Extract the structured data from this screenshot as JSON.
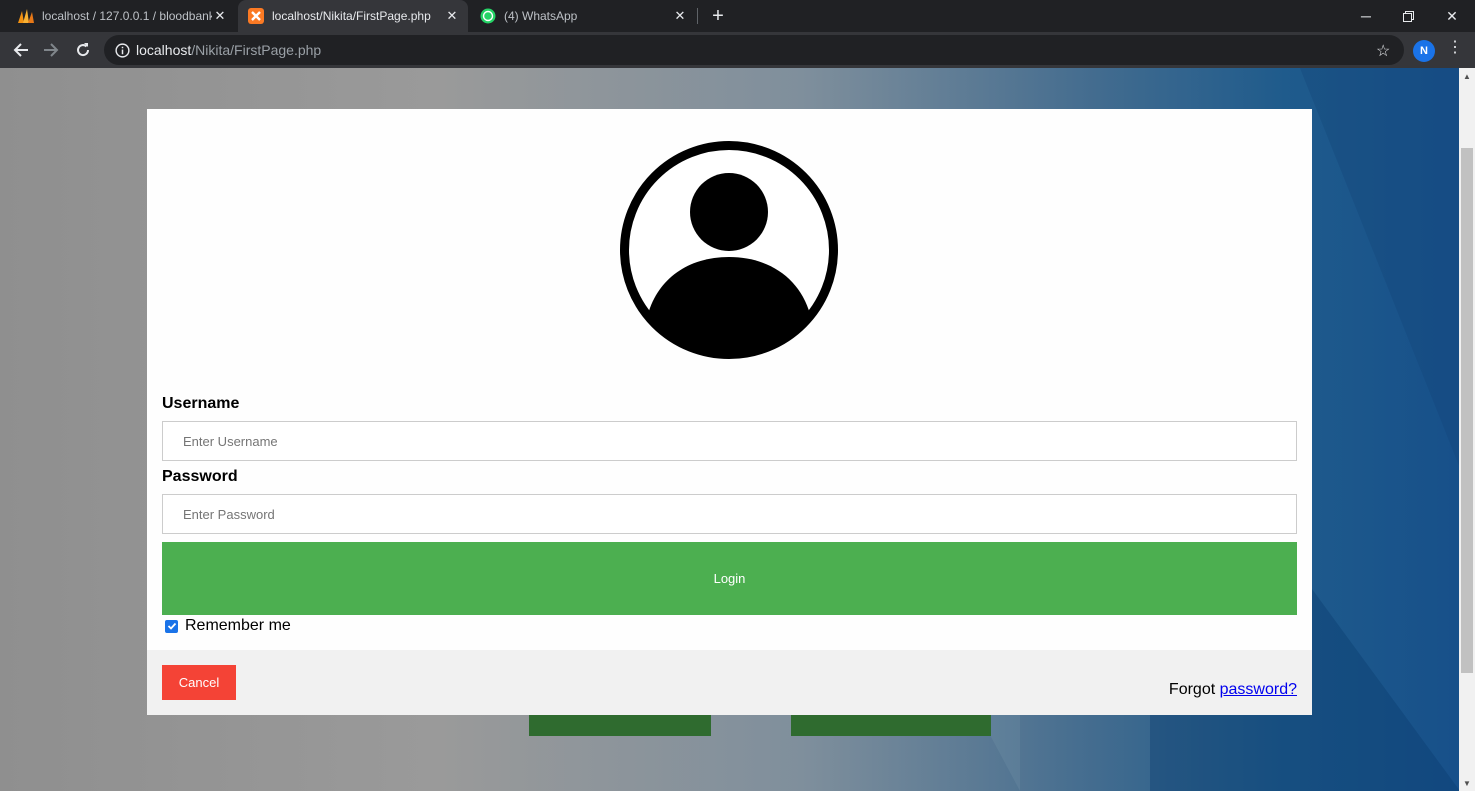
{
  "browser": {
    "tabs": [
      {
        "title": "localhost / 127.0.0.1 / bloodbank",
        "favicon": "phpmyadmin-icon",
        "active": false
      },
      {
        "title": "localhost/Nikita/FirstPage.php",
        "favicon": "xampp-icon",
        "active": true
      },
      {
        "title": "(4) WhatsApp",
        "favicon": "whatsapp-icon",
        "active": false
      }
    ],
    "url_host": "localhost",
    "url_path": "/Nikita/FirstPage.php",
    "profile_initial": "N"
  },
  "login": {
    "username_label": "Username",
    "username_placeholder": "Enter Username",
    "username_value": "",
    "password_label": "Password",
    "password_placeholder": "Enter Password",
    "password_value": "",
    "login_button": "Login",
    "remember_label": "Remember me",
    "remember_checked": true,
    "cancel_button": "Cancel",
    "forgot_text": "Forgot",
    "forgot_link": "password?"
  },
  "colors": {
    "login_green": "#4caf50",
    "cancel_red": "#f44336",
    "link_blue": "#0000ee",
    "checkbox_blue": "#1a73e8"
  }
}
